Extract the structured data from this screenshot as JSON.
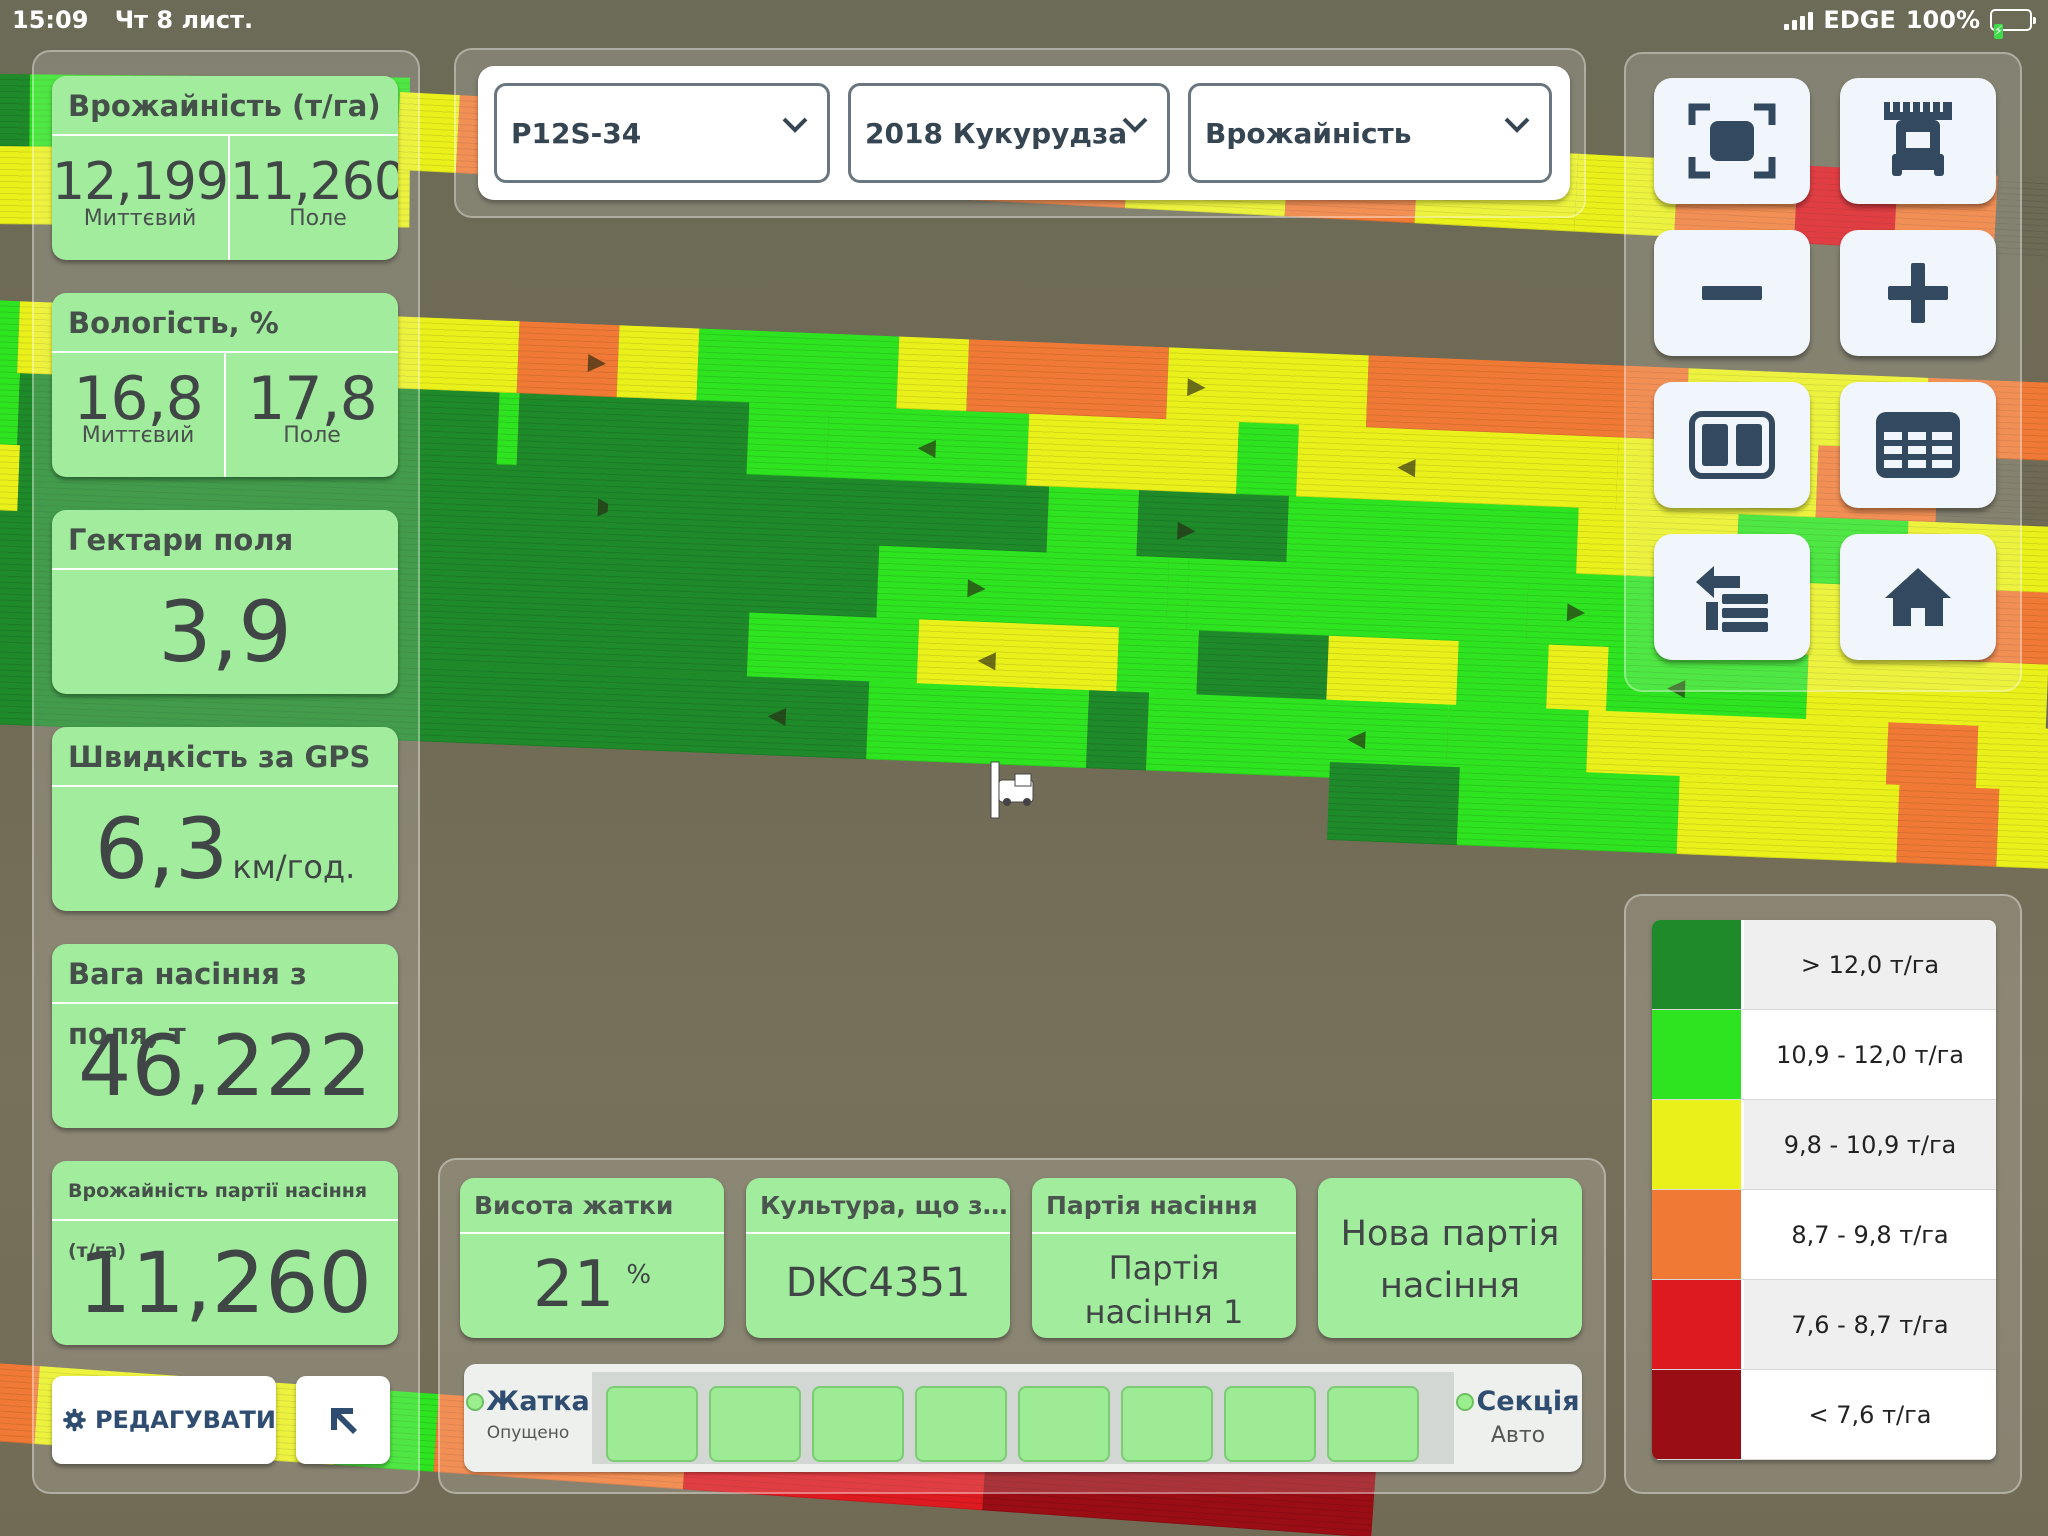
{
  "status_bar": {
    "time": "15:09",
    "date": "Чт 8 лист.",
    "network": "EDGE",
    "battery": "100%"
  },
  "left_cards": {
    "yield": {
      "title": "Врожайність (т/га)",
      "instant_value": "12,199",
      "instant_label": "Миттєвий",
      "field_value": "11,260",
      "field_label": "Поле"
    },
    "moisture": {
      "title": "Вологість, %",
      "instant_value": "16,8",
      "instant_label": "Миттєвий",
      "field_value": "17,8",
      "field_label": "Поле"
    },
    "hectares": {
      "title": "Гектари поля",
      "value": "3,9"
    },
    "speed": {
      "title": "Швидкість за GPS",
      "value": "6,3",
      "unit": "км/год."
    },
    "seed_weight": {
      "title": "Вага насіння з поля, т",
      "value": "46,222"
    },
    "lot_yield": {
      "title": "Врожайність партії насіння (т/га)",
      "value": "11,260"
    }
  },
  "edit_button": {
    "label": "РЕДАГУВАТИ"
  },
  "dropdowns": {
    "field": "P12S-34",
    "season_crop": "2018 Кукурудза",
    "layer": "Врожайність"
  },
  "map_controls": [
    "fit-extent",
    "harvester-view",
    "zoom-out",
    "zoom-in",
    "split-view",
    "table-view",
    "switch-layer",
    "home"
  ],
  "legend": [
    {
      "color": "#1f8a2a",
      "label": "> 12,0 т/га"
    },
    {
      "color": "#2ee31f",
      "label": "10,9 - 12,0 т/га"
    },
    {
      "color": "#e9f01a",
      "label": "9,8 - 10,9 т/га"
    },
    {
      "color": "#f07a35",
      "label": "8,7 - 9,8 т/га"
    },
    {
      "color": "#dc1a1f",
      "label": "7,6 - 8,7 т/га"
    },
    {
      "color": "#9a0d15",
      "label": "< 7,6 т/га"
    }
  ],
  "bottom_cards": {
    "header_height": {
      "title": "Висота жатки",
      "value": "21",
      "unit": "%"
    },
    "crop": {
      "title": "Культура, що з…",
      "value": "DKC4351"
    },
    "seed_lot": {
      "title": "Партія насіння",
      "value_line1": "Партія",
      "value_line2": "насіння 1"
    },
    "new_lot": {
      "line1": "Нова партія",
      "line2": "насіння"
    }
  },
  "sections_bar": {
    "left": {
      "title": "Жатка",
      "status": "Опущено"
    },
    "right": {
      "title": "Секція",
      "status": "Авто"
    },
    "section_count": 8
  }
}
